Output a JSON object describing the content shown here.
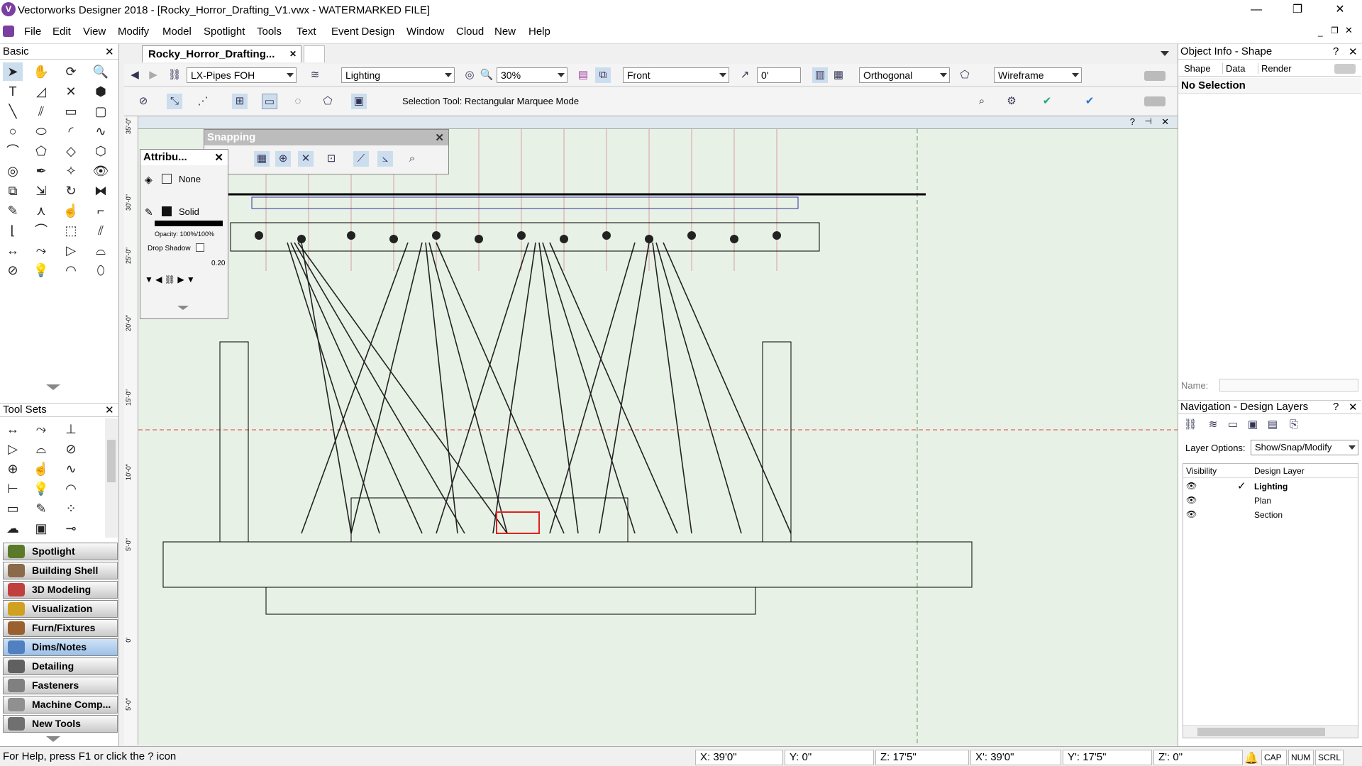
{
  "window": {
    "title": "Vectorworks Designer 2018 - [Rocky_Horror_Drafting_V1.vwx - WATERMARKED FILE]",
    "app_icon": "V",
    "minimize": "—",
    "restore": "❐",
    "close": "✕"
  },
  "menu": [
    "File",
    "Edit",
    "View",
    "Modify",
    "Model",
    "Spotlight",
    "Tools",
    "Text",
    "Event Design",
    "Window",
    "Cloud",
    "New",
    "Help"
  ],
  "basic_palette": {
    "title": "Basic"
  },
  "tool_sets_palette": {
    "title": "Tool Sets"
  },
  "tool_sets": [
    {
      "label": "Spotlight",
      "color": "#5a7a2a"
    },
    {
      "label": "Building Shell",
      "color": "#8a6a4a"
    },
    {
      "label": "3D Modeling",
      "color": "#c04040"
    },
    {
      "label": "Visualization",
      "color": "#d0a020"
    },
    {
      "label": "Furn/Fixtures",
      "color": "#9a6030"
    },
    {
      "label": "Dims/Notes",
      "color": "#5080c0"
    },
    {
      "label": "Detailing",
      "color": "#606060"
    },
    {
      "label": "Fasteners",
      "color": "#808080"
    },
    {
      "label": "Machine Comp...",
      "color": "#909090"
    },
    {
      "label": "New Tools",
      "color": "#707070"
    }
  ],
  "document_tab": {
    "label": "Rocky_Horror_Drafting...",
    "close": "✕"
  },
  "view_bar": {
    "class": "LX-Pipes FOH",
    "layer": "Lighting",
    "zoom": "30%",
    "view": "Front",
    "rotation": "0'",
    "projection": "Orthogonal",
    "render_mode": "Wireframe"
  },
  "mode_bar": {
    "hint": "Selection Tool: Rectangular Marquee Mode"
  },
  "snapping_palette": {
    "title": "Snapping"
  },
  "attributes_palette": {
    "title": "Attribu...",
    "fill": "None",
    "pen": "Solid",
    "opacity": "Opacity: 100%/100%",
    "drop_shadow": "Drop Shadow",
    "line_weight": "0.20"
  },
  "ruler_labels": [
    "35'-0\"",
    "30'-0\"",
    "25'-0\"",
    "20'-0\"",
    "15'-0\"",
    "10'-0\"",
    "5'-0\"",
    "0'",
    "5'-0\""
  ],
  "object_info": {
    "title": "Object Info - Shape",
    "tabs": [
      "Shape",
      "Data",
      "Render"
    ],
    "selection": "No Selection",
    "name_label": "Name:"
  },
  "navigation": {
    "title": "Navigation - Design Layers",
    "layer_options_label": "Layer Options:",
    "layer_options_value": "Show/Snap/Modify",
    "col_visibility": "Visibility",
    "col_design_layer": "Design Layer",
    "layers": [
      {
        "name": "Lighting",
        "active": true
      },
      {
        "name": "Plan",
        "active": false
      },
      {
        "name": "Section",
        "active": false
      }
    ]
  },
  "status": {
    "help": "For Help, press F1 or click the ? icon",
    "x": "X: 39'0\"",
    "y": "Y: 0\"",
    "z": "Z: 17'5\"",
    "x2": "X': 39'0\"",
    "y2": "Y': 17'5\"",
    "z2": "Z': 0\"",
    "cap": "CAP",
    "num": "NUM",
    "scrl": "SCRL"
  }
}
